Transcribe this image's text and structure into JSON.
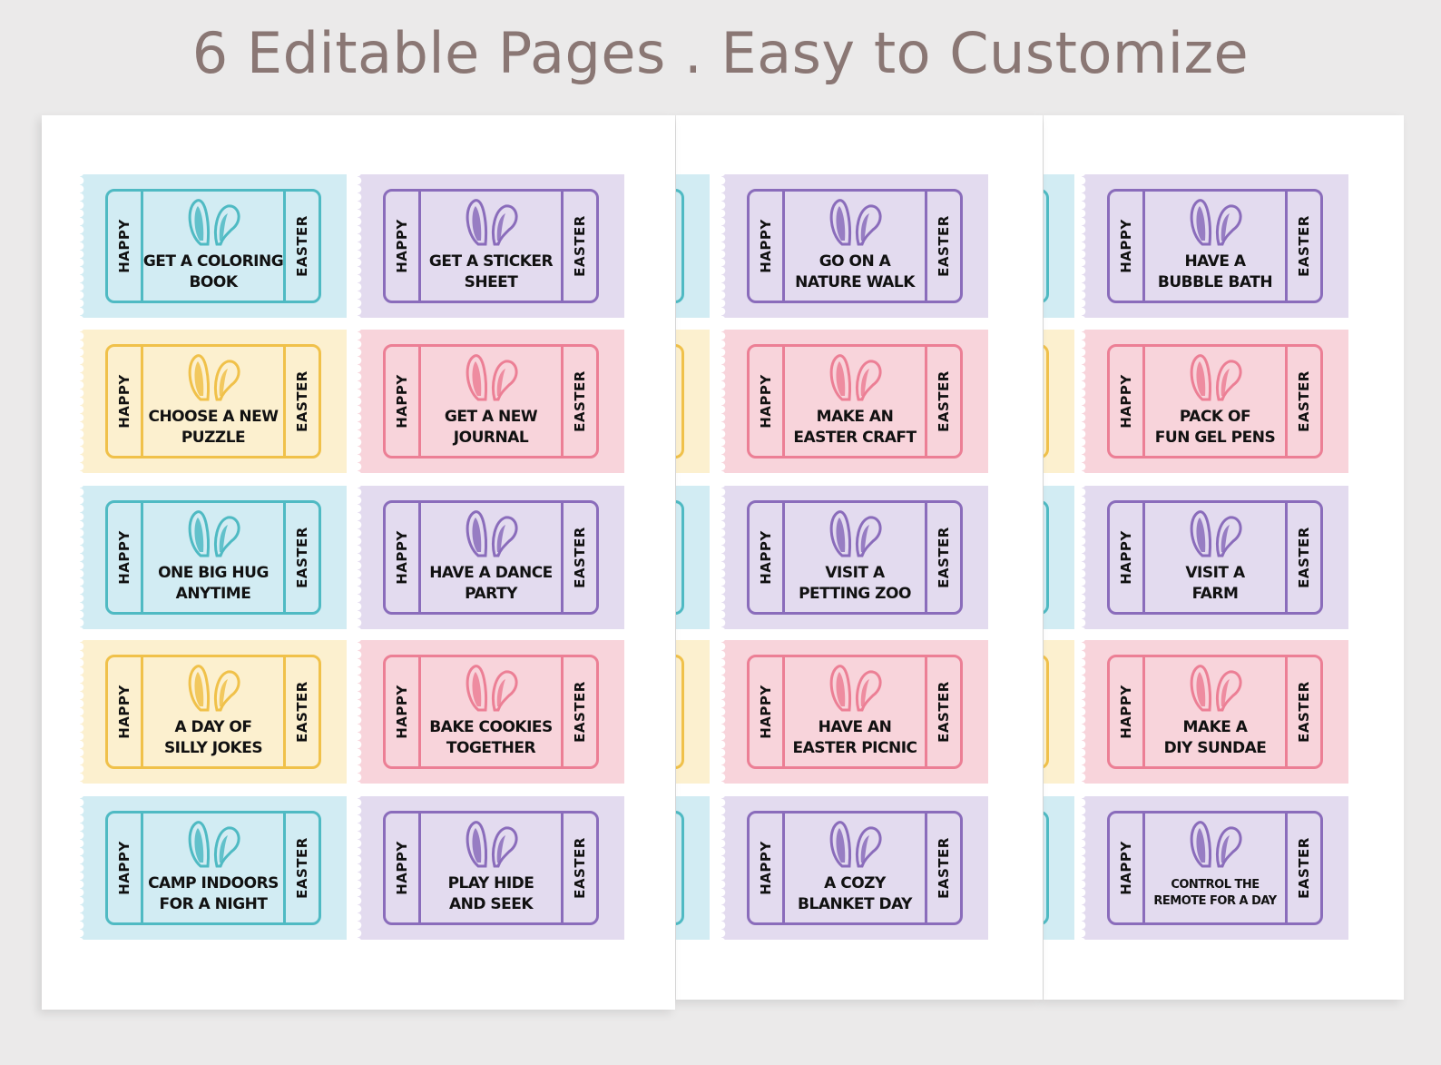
{
  "headline": "6 Editable Pages . Easy to Customize",
  "colors": {
    "background": "#ebeaea",
    "headline": "#8a7774",
    "blue": "#4fbac3",
    "purple": "#8a6cbb",
    "yellow": "#f0c14a",
    "pink": "#ec7f95"
  },
  "ticket_left_label": "HAPPY",
  "ticket_right_label": "EASTER",
  "page1": {
    "tickets": [
      {
        "text": "GET A COLORING\nBOOK",
        "color": "blue"
      },
      {
        "text": "GET A STICKER\nSHEET",
        "color": "purple"
      },
      {
        "text": "CHOOSE A NEW\nPUZZLE",
        "color": "yellow"
      },
      {
        "text": "GET A NEW\nJOURNAL",
        "color": "pink"
      },
      {
        "text": "ONE BIG HUG\nANYTIME",
        "color": "blue"
      },
      {
        "text": "HAVE A DANCE\nPARTY",
        "color": "purple"
      },
      {
        "text": "A DAY OF\nSILLY JOKES",
        "color": "yellow"
      },
      {
        "text": "BAKE COOKIES\nTOGETHER",
        "color": "pink"
      },
      {
        "text": "CAMP INDOORS\nFOR A NIGHT",
        "color": "blue"
      },
      {
        "text": "PLAY HIDE\nAND SEEK",
        "color": "purple"
      }
    ]
  },
  "page2": {
    "tickets": [
      {
        "text": "GO ON A\nNATURE WALK",
        "color": "purple"
      },
      {
        "text": "MAKE AN\nEASTER CRAFT",
        "color": "pink"
      },
      {
        "text": "VISIT A\nPETTING ZOO",
        "color": "purple"
      },
      {
        "text": "HAVE AN\nEASTER PICNIC",
        "color": "pink"
      },
      {
        "text": "A COZY\nBLANKET DAY",
        "color": "purple"
      }
    ]
  },
  "page3": {
    "tickets": [
      {
        "text": "HAVE A\nBUBBLE BATH",
        "color": "purple"
      },
      {
        "text": "PACK OF\nFUN GEL PENS",
        "color": "pink"
      },
      {
        "text": "VISIT A\nFARM",
        "color": "purple"
      },
      {
        "text": "MAKE A\nDIY SUNDAE",
        "color": "pink"
      },
      {
        "text": "CONTROL THE\nREMOTE FOR A DAY",
        "color": "purple",
        "small": true
      }
    ]
  },
  "peek_colors_page2": [
    "blue",
    "yellow",
    "blue",
    "yellow",
    "blue"
  ],
  "peek_colors_page3": [
    "blue",
    "yellow",
    "blue",
    "yellow",
    "blue"
  ],
  "icon": "bunny-ears-icon"
}
